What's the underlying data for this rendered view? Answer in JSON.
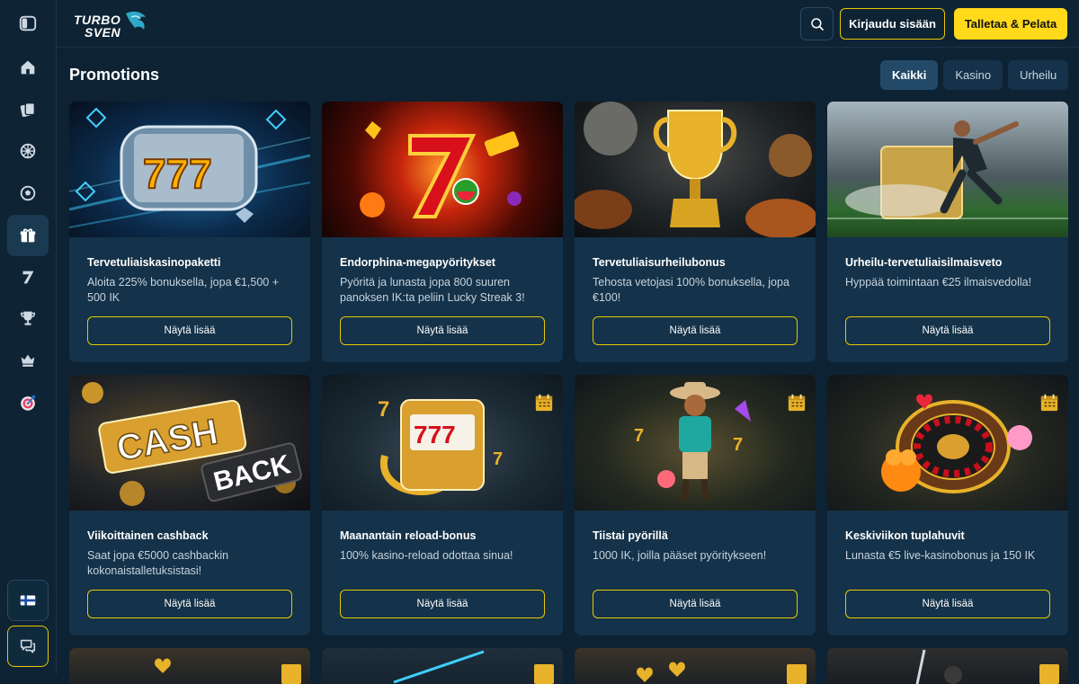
{
  "header": {
    "logo_text": "TURBO SVEN",
    "login_label": "Kirjaudu sisään",
    "deposit_label": "Talletaa & Pelata"
  },
  "page": {
    "title": "Promotions"
  },
  "filters": [
    {
      "label": "Kaikki",
      "active": true
    },
    {
      "label": "Kasino",
      "active": false
    },
    {
      "label": "Urheilu",
      "active": false
    }
  ],
  "cards": [
    {
      "title": "Tervetuliaiskasinopaketti",
      "desc": "Aloita 225% bonuksella, jopa €1,500 + 500 IK",
      "button": "Näytä lisää"
    },
    {
      "title": "Endorphina-megapyöritykset",
      "desc": "Pyöritä ja lunasta jopa 800 suuren panoksen IK:ta peliin Lucky Streak 3!",
      "button": "Näytä lisää"
    },
    {
      "title": "Tervetuliaisurheilubonus",
      "desc": "Tehosta vetojasi 100% bonuksella, jopa €100!",
      "button": "Näytä lisää"
    },
    {
      "title": "Urheilu-tervetuliaisilmaisveto",
      "desc": "Hyppää toimintaan €25 ilmaisvedolla!",
      "button": "Näytä lisää"
    },
    {
      "title": "Viikoittainen cashback",
      "desc": "Saat jopa €5000 cashbackin kokonaistalletuksistasi!",
      "button": "Näytä lisää",
      "image_text_1": "CASH",
      "image_text_2": "BACK"
    },
    {
      "title": "Maanantain reload-bonus",
      "desc": "100% kasino-reload odottaa sinua!",
      "button": "Näytä lisää"
    },
    {
      "title": "Tiistai pyörillä",
      "desc": "1000 IK, joilla pääset pyöritykseen!",
      "button": "Näytä lisää"
    },
    {
      "title": "Keskiviikon tuplahuvit",
      "desc": "Lunasta €5 live-kasinobonus ja 150 IK",
      "button": "Näytä lisää"
    }
  ],
  "colors": {
    "accent": "#ffd91a",
    "background": "#0d2233",
    "card": "#143249"
  }
}
